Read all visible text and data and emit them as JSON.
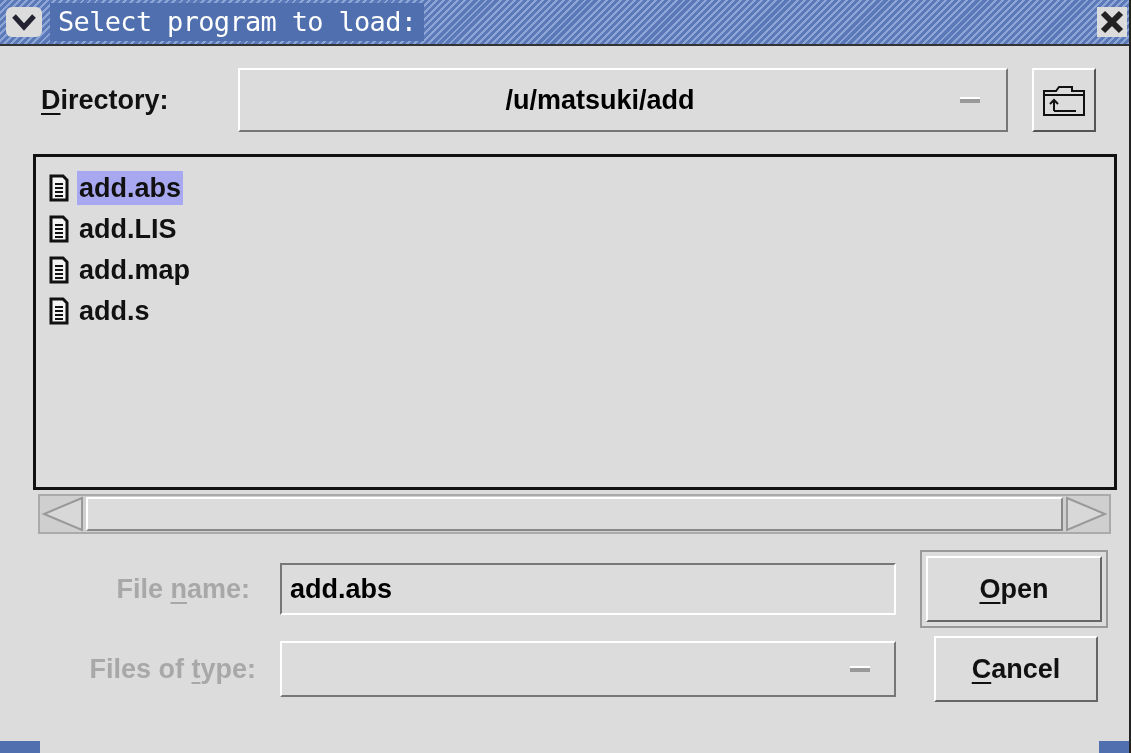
{
  "window": {
    "title": "Select program to load:"
  },
  "directory": {
    "label": [
      {
        "text": "D",
        "underlined": true
      },
      {
        "text": "irectory:",
        "underlined": false
      }
    ],
    "disabled": false,
    "value": "/u/matsuki/add"
  },
  "files": [
    {
      "name": "add.abs",
      "selected": true
    },
    {
      "name": "add.LIS",
      "selected": false
    },
    {
      "name": "add.map",
      "selected": false
    },
    {
      "name": "add.s",
      "selected": false
    }
  ],
  "file_name": {
    "label": [
      {
        "text": "File ",
        "underlined": false
      },
      {
        "text": "n",
        "underlined": true
      },
      {
        "text": "ame:",
        "underlined": false
      }
    ],
    "disabled": true,
    "value": "add.abs"
  },
  "files_of_type": {
    "label": [
      {
        "text": "Files of ",
        "underlined": false
      },
      {
        "text": "t",
        "underlined": true
      },
      {
        "text": "ype:",
        "underlined": false
      }
    ],
    "disabled": true
  },
  "buttons": [
    {
      "label": [
        {
          "text": "O",
          "underlined": true
        },
        {
          "text": "pen",
          "underlined": false
        }
      ],
      "default": true
    },
    {
      "label": [
        {
          "text": "C",
          "underlined": true
        },
        {
          "text": "ancel",
          "underlined": false
        }
      ],
      "default": false
    }
  ]
}
